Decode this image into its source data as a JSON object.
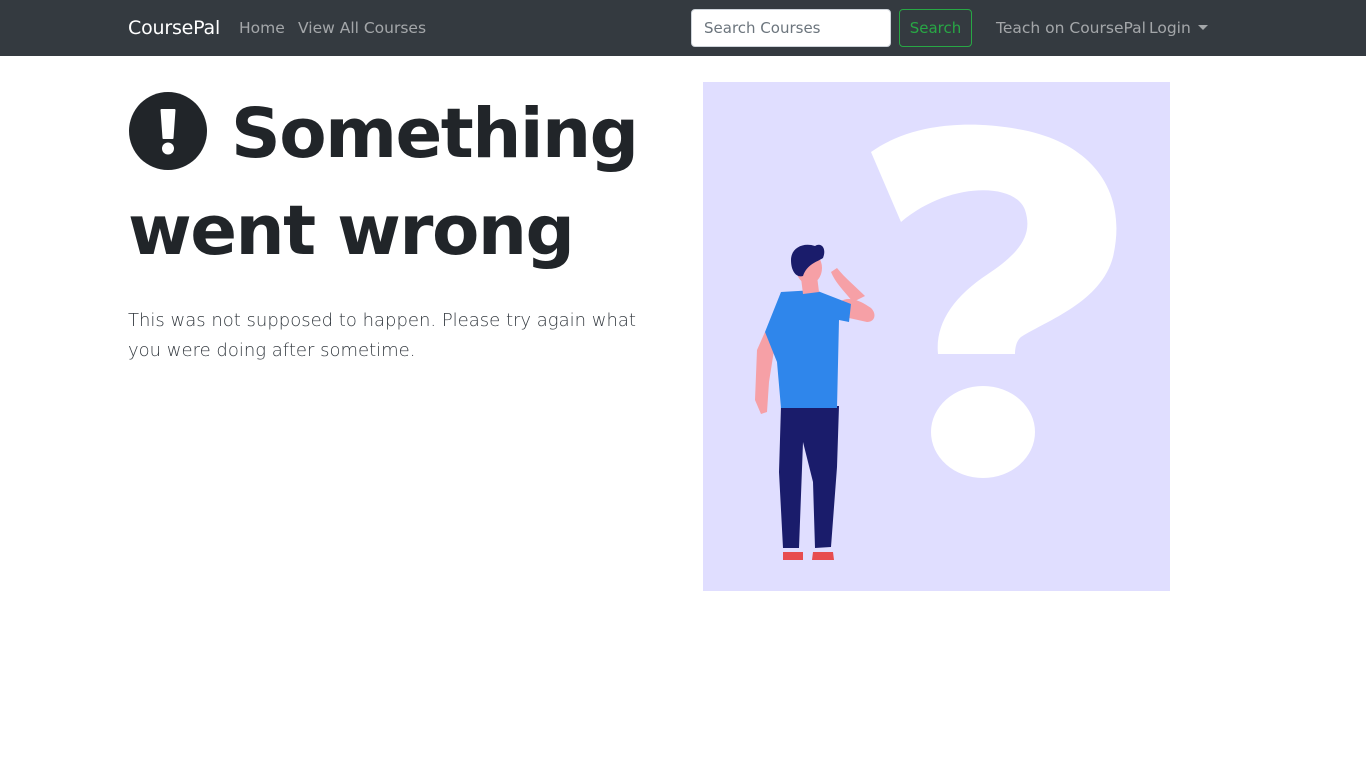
{
  "navbar": {
    "brand": "CoursePal",
    "links": {
      "home": "Home",
      "all_courses": "View All Courses",
      "teach": "Teach on CoursePal",
      "login": "Login"
    },
    "search": {
      "placeholder": "Search Courses",
      "value": "",
      "button_label": "Search"
    }
  },
  "main": {
    "icon": "exclamation-circle-icon",
    "title": "Something went wrong",
    "message": "This was not supposed to happen. Please try again what you were doing after sometime.",
    "illustration": "person-with-question-mark-illustration"
  },
  "colors": {
    "navbar_bg": "#343a40",
    "search_button": "#28a745",
    "illustration_bg": "#e0deff",
    "shirt": "#2f86eb",
    "pants": "#1a1c6b",
    "skin": "#f6a0a6",
    "shoes": "#e74c4f"
  }
}
